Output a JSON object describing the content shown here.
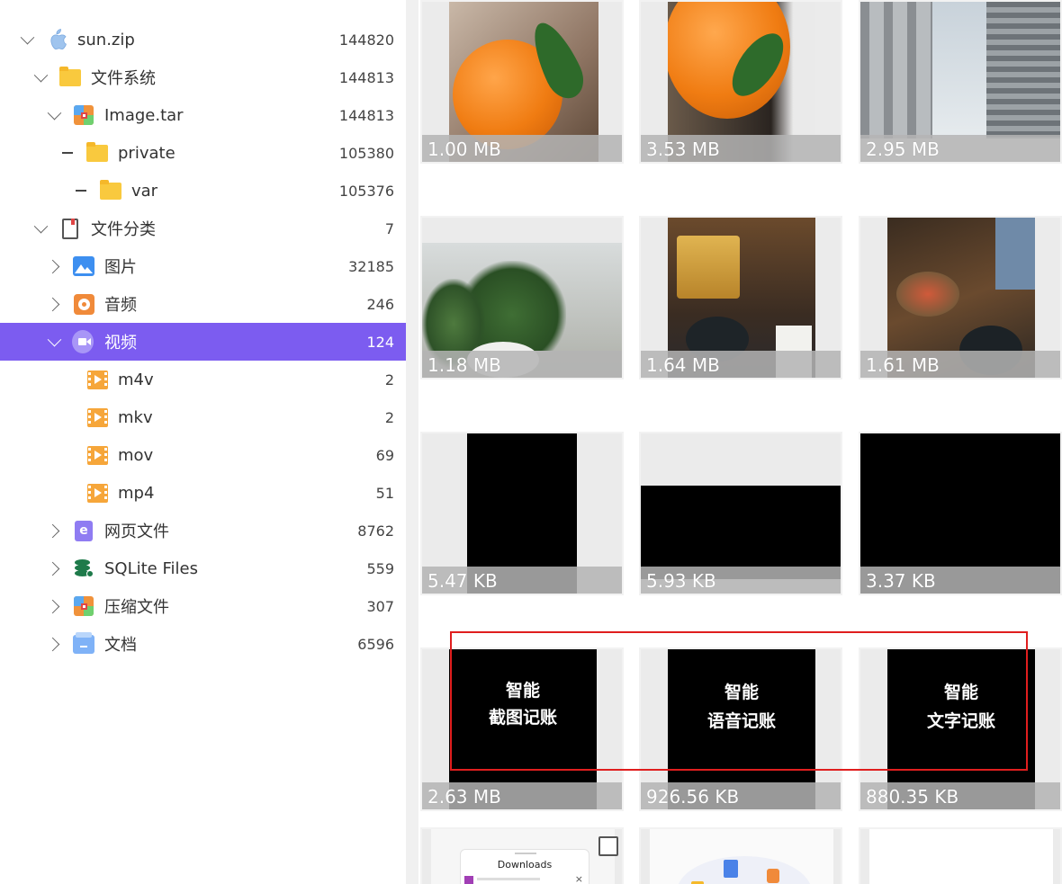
{
  "tree": {
    "root": {
      "label": "sun.zip",
      "count": "144820"
    },
    "filesystem": {
      "label": "文件系统",
      "count": "144813"
    },
    "image_tar": {
      "label": "Image.tar",
      "count": "144813"
    },
    "private": {
      "label": "private",
      "count": "105380"
    },
    "var": {
      "label": "var",
      "count": "105376"
    },
    "categories": {
      "label": "文件分类",
      "count": "7"
    },
    "pictures": {
      "label": "图片",
      "count": "32185"
    },
    "audio": {
      "label": "音频",
      "count": "246"
    },
    "video": {
      "label": "视频",
      "count": "124"
    },
    "m4v": {
      "label": "m4v",
      "count": "2"
    },
    "mkv": {
      "label": "mkv",
      "count": "2"
    },
    "mov": {
      "label": "mov",
      "count": "69"
    },
    "mp4": {
      "label": "mp4",
      "count": "51"
    },
    "web": {
      "label": "网页文件",
      "count": "8762"
    },
    "sqlite": {
      "label": "SQLite Files",
      "count": "559"
    },
    "archives": {
      "label": "压缩文件",
      "count": "307"
    },
    "documents": {
      "label": "文档",
      "count": "6596"
    }
  },
  "thumbnails": [
    {
      "size": "1.00 MB",
      "content": "orange"
    },
    {
      "size": "3.53 MB",
      "content": "orange"
    },
    {
      "size": "2.95 MB",
      "content": "skyscrapers"
    },
    {
      "size": "1.18 MB",
      "content": "office plants"
    },
    {
      "size": "1.64 MB",
      "content": "skewers"
    },
    {
      "size": "1.61 MB",
      "content": "dinner table"
    },
    {
      "size": "5.47 KB",
      "content": "black"
    },
    {
      "size": "5.93 KB",
      "content": "black"
    },
    {
      "size": "3.37 KB",
      "content": "black"
    },
    {
      "size": "2.63 MB",
      "content": "promo",
      "line1": "智能",
      "line2": "截图记账"
    },
    {
      "size": "926.56 KB",
      "content": "promo",
      "line1": "智能",
      "line2": "语音记账"
    },
    {
      "size": "880.35 KB",
      "content": "promo",
      "line1": "智能",
      "line2": "文字记账"
    }
  ],
  "partial_row": {
    "downloads_label": "Downloads"
  },
  "colors": {
    "selected": "#7c5cf0",
    "highlight": "#e01e1e"
  }
}
